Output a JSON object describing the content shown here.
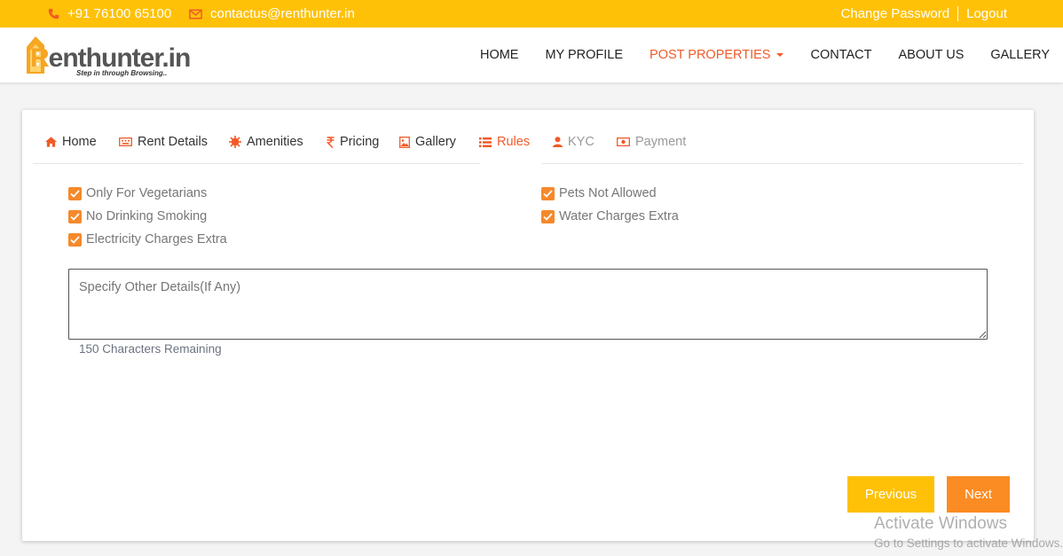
{
  "topbar": {
    "phone": "+91 76100 65100",
    "email": "contactus@renthunter.in",
    "change_password": "Change Password",
    "logout": "Logout"
  },
  "logo": {
    "text_orange": "R",
    "text_rest": "enthunter.in",
    "tagline": "Step in through Browsing.."
  },
  "nav": {
    "items": [
      "HOME",
      "MY PROFILE",
      "POST PROPERTIES",
      "CONTACT",
      "ABOUT US",
      "GALLERY"
    ],
    "active_index": 2
  },
  "tabs": [
    {
      "label": "Home",
      "icon": "home-icon",
      "state": "normal"
    },
    {
      "label": "Rent Details",
      "icon": "keyboard-icon",
      "state": "normal"
    },
    {
      "label": "Amenities",
      "icon": "star-burst-icon",
      "state": "normal"
    },
    {
      "label": "Pricing",
      "icon": "rupee-icon",
      "state": "normal"
    },
    {
      "label": "Gallery",
      "icon": "image-icon",
      "state": "normal"
    },
    {
      "label": "Rules",
      "icon": "list-icon",
      "state": "active"
    },
    {
      "label": "KYC",
      "icon": "user-icon",
      "state": "disabled"
    },
    {
      "label": "Payment",
      "icon": "money-icon",
      "state": "disabled"
    }
  ],
  "rules": {
    "left": [
      "Only For Vegetarians",
      "No Drinking Smoking",
      "Electricity Charges Extra"
    ],
    "right": [
      "Pets Not Allowed",
      "Water Charges Extra"
    ],
    "checked": true
  },
  "other_details": {
    "placeholder": "Specify Other Details(If Any)",
    "value": "",
    "remaining": "150 Characters Remaining"
  },
  "buttons": {
    "previous": "Previous",
    "next": "Next"
  },
  "watermark": {
    "line1": "Activate Windows",
    "line2": "Go to Settings to activate Windows."
  },
  "colors": {
    "topbar": "#ffc107",
    "accent": "#f05a28",
    "checkbox": "#f5892b",
    "next_button": "#fb8c24",
    "previous_button": "#ffc107"
  }
}
